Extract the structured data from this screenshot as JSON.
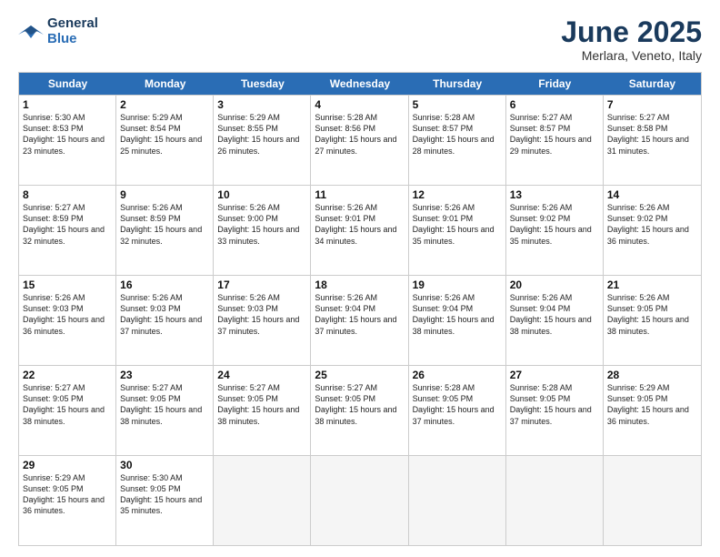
{
  "logo": {
    "line1": "General",
    "line2": "Blue"
  },
  "title": {
    "month": "June 2025",
    "location": "Merlara, Veneto, Italy"
  },
  "days_of_week": [
    "Sunday",
    "Monday",
    "Tuesday",
    "Wednesday",
    "Thursday",
    "Friday",
    "Saturday"
  ],
  "weeks": [
    [
      {
        "day": 1,
        "sunrise": "5:30 AM",
        "sunset": "8:53 PM",
        "daylight": "15 hours and 23 minutes."
      },
      {
        "day": 2,
        "sunrise": "5:29 AM",
        "sunset": "8:54 PM",
        "daylight": "15 hours and 25 minutes."
      },
      {
        "day": 3,
        "sunrise": "5:29 AM",
        "sunset": "8:55 PM",
        "daylight": "15 hours and 26 minutes."
      },
      {
        "day": 4,
        "sunrise": "5:28 AM",
        "sunset": "8:56 PM",
        "daylight": "15 hours and 27 minutes."
      },
      {
        "day": 5,
        "sunrise": "5:28 AM",
        "sunset": "8:57 PM",
        "daylight": "15 hours and 28 minutes."
      },
      {
        "day": 6,
        "sunrise": "5:27 AM",
        "sunset": "8:57 PM",
        "daylight": "15 hours and 29 minutes."
      },
      {
        "day": 7,
        "sunrise": "5:27 AM",
        "sunset": "8:58 PM",
        "daylight": "15 hours and 31 minutes."
      }
    ],
    [
      {
        "day": 8,
        "sunrise": "5:27 AM",
        "sunset": "8:59 PM",
        "daylight": "15 hours and 32 minutes."
      },
      {
        "day": 9,
        "sunrise": "5:26 AM",
        "sunset": "8:59 PM",
        "daylight": "15 hours and 32 minutes."
      },
      {
        "day": 10,
        "sunrise": "5:26 AM",
        "sunset": "9:00 PM",
        "daylight": "15 hours and 33 minutes."
      },
      {
        "day": 11,
        "sunrise": "5:26 AM",
        "sunset": "9:01 PM",
        "daylight": "15 hours and 34 minutes."
      },
      {
        "day": 12,
        "sunrise": "5:26 AM",
        "sunset": "9:01 PM",
        "daylight": "15 hours and 35 minutes."
      },
      {
        "day": 13,
        "sunrise": "5:26 AM",
        "sunset": "9:02 PM",
        "daylight": "15 hours and 35 minutes."
      },
      {
        "day": 14,
        "sunrise": "5:26 AM",
        "sunset": "9:02 PM",
        "daylight": "15 hours and 36 minutes."
      }
    ],
    [
      {
        "day": 15,
        "sunrise": "5:26 AM",
        "sunset": "9:03 PM",
        "daylight": "15 hours and 36 minutes."
      },
      {
        "day": 16,
        "sunrise": "5:26 AM",
        "sunset": "9:03 PM",
        "daylight": "15 hours and 37 minutes."
      },
      {
        "day": 17,
        "sunrise": "5:26 AM",
        "sunset": "9:03 PM",
        "daylight": "15 hours and 37 minutes."
      },
      {
        "day": 18,
        "sunrise": "5:26 AM",
        "sunset": "9:04 PM",
        "daylight": "15 hours and 37 minutes."
      },
      {
        "day": 19,
        "sunrise": "5:26 AM",
        "sunset": "9:04 PM",
        "daylight": "15 hours and 38 minutes."
      },
      {
        "day": 20,
        "sunrise": "5:26 AM",
        "sunset": "9:04 PM",
        "daylight": "15 hours and 38 minutes."
      },
      {
        "day": 21,
        "sunrise": "5:26 AM",
        "sunset": "9:05 PM",
        "daylight": "15 hours and 38 minutes."
      }
    ],
    [
      {
        "day": 22,
        "sunrise": "5:27 AM",
        "sunset": "9:05 PM",
        "daylight": "15 hours and 38 minutes."
      },
      {
        "day": 23,
        "sunrise": "5:27 AM",
        "sunset": "9:05 PM",
        "daylight": "15 hours and 38 minutes."
      },
      {
        "day": 24,
        "sunrise": "5:27 AM",
        "sunset": "9:05 PM",
        "daylight": "15 hours and 38 minutes."
      },
      {
        "day": 25,
        "sunrise": "5:27 AM",
        "sunset": "9:05 PM",
        "daylight": "15 hours and 38 minutes."
      },
      {
        "day": 26,
        "sunrise": "5:28 AM",
        "sunset": "9:05 PM",
        "daylight": "15 hours and 37 minutes."
      },
      {
        "day": 27,
        "sunrise": "5:28 AM",
        "sunset": "9:05 PM",
        "daylight": "15 hours and 37 minutes."
      },
      {
        "day": 28,
        "sunrise": "5:29 AM",
        "sunset": "9:05 PM",
        "daylight": "15 hours and 36 minutes."
      }
    ],
    [
      {
        "day": 29,
        "sunrise": "5:29 AM",
        "sunset": "9:05 PM",
        "daylight": "15 hours and 36 minutes."
      },
      {
        "day": 30,
        "sunrise": "5:30 AM",
        "sunset": "9:05 PM",
        "daylight": "15 hours and 35 minutes."
      },
      null,
      null,
      null,
      null,
      null
    ]
  ]
}
